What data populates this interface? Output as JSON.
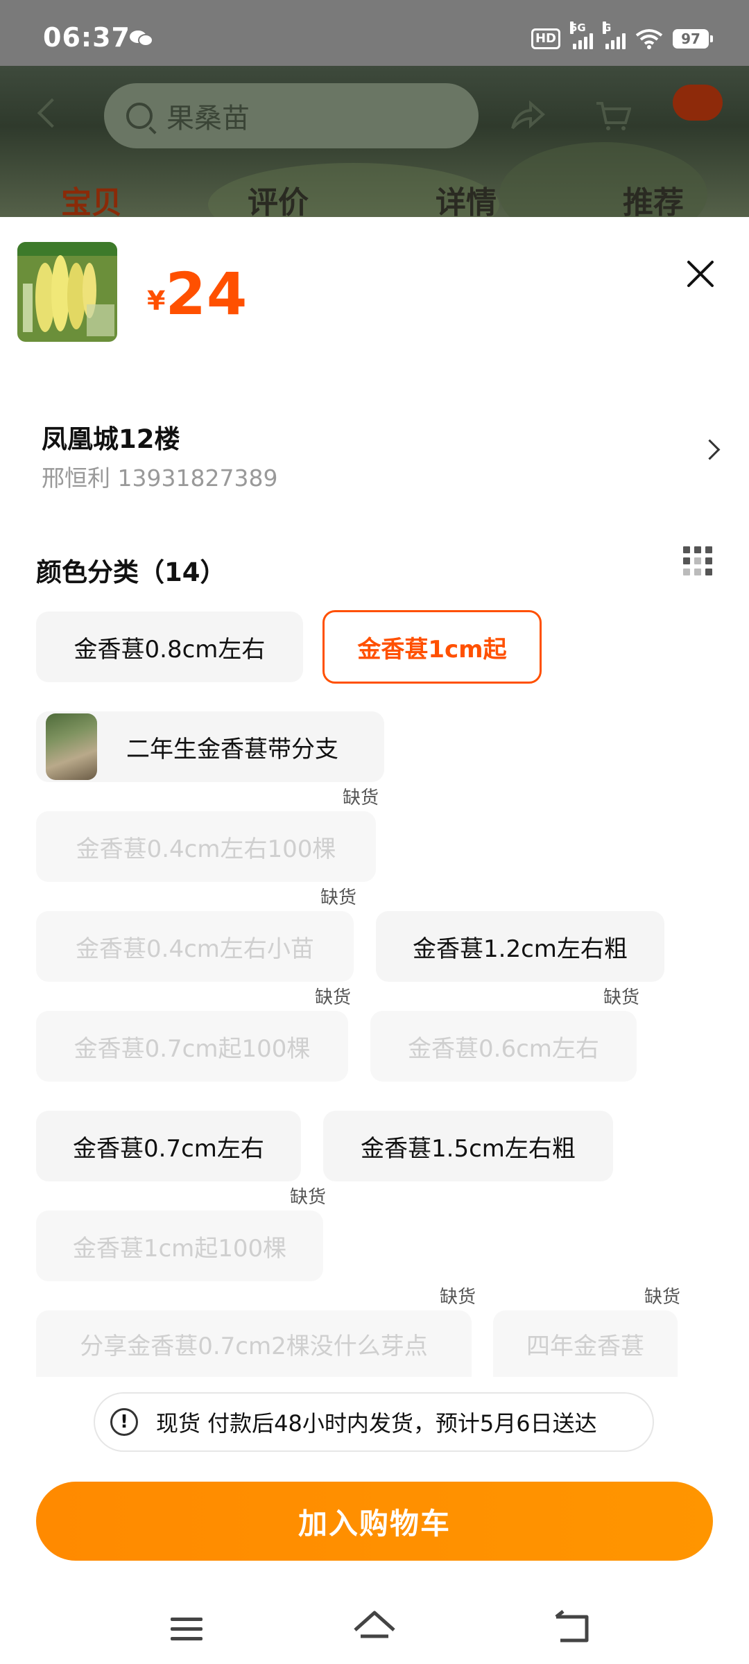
{
  "status_bar": {
    "time": "06:37",
    "network_1": "5G",
    "network_2": "G",
    "battery": "97",
    "hd": "HD"
  },
  "background_page": {
    "search_placeholder": "果桑苗",
    "tabs": [
      "宝贝",
      "评价",
      "详情",
      "推荐"
    ]
  },
  "sheet": {
    "price_symbol": "¥",
    "price": "24",
    "address": {
      "name": "凤凰城12楼",
      "contact": "邢恒利 13931827389"
    },
    "section_title": "颜色分类（14）",
    "out_of_stock_label": "缺货",
    "options": [
      {
        "label": "金香葚0.8cm左右",
        "state": "normal"
      },
      {
        "label": "金香葚1cm起",
        "state": "selected"
      },
      {
        "label": "二年生金香葚带分支",
        "state": "normal",
        "has_image": true
      },
      {
        "label": "金香葚0.4cm左右100棵",
        "state": "out_of_stock"
      },
      {
        "label": "金香葚0.4cm左右小苗",
        "state": "out_of_stock"
      },
      {
        "label": "金香葚1.2cm左右粗",
        "state": "normal"
      },
      {
        "label": "金香葚0.7cm起100棵",
        "state": "out_of_stock"
      },
      {
        "label": "金香葚0.6cm左右",
        "state": "out_of_stock"
      },
      {
        "label": "金香葚0.7cm左右",
        "state": "normal"
      },
      {
        "label": "金香葚1.5cm左右粗",
        "state": "normal"
      },
      {
        "label": "金香葚1cm起100棵",
        "state": "out_of_stock"
      },
      {
        "label": "分享金香葚0.7cm2棵没什么芽点",
        "state": "out_of_stock"
      },
      {
        "label": "四年金香葚",
        "state": "out_of_stock"
      }
    ],
    "notice": "现货 付款后48小时内发货，预计5月6日送达",
    "add_to_cart": "加入购物车"
  },
  "colors": {
    "accent": "#ff5000",
    "button": "#ff8a00"
  }
}
